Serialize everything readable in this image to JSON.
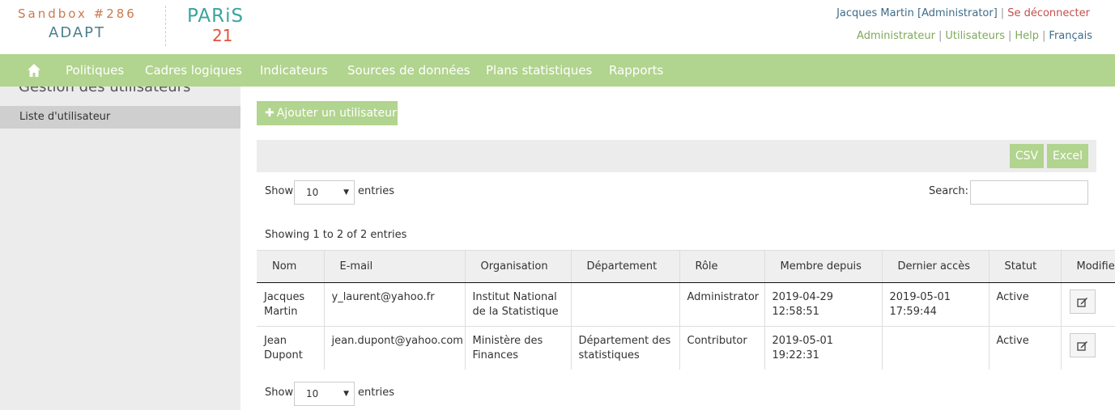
{
  "header": {
    "sandbox": "Sandbox #286",
    "adapt": "ADAPT",
    "paris": "PARiS",
    "paris_num": "21",
    "user": "Jacques Martin [Administrator]",
    "separator": "|",
    "logout": "Se déconnecter",
    "links": [
      "Administrateur",
      "Utilisateurs",
      "Help",
      "Français"
    ]
  },
  "nav": {
    "home_icon": "home-icon",
    "items": [
      "Politiques",
      "Cadres logiques",
      "Indicateurs",
      "Sources de données",
      "Plans statistiques",
      "Rapports"
    ]
  },
  "sidebar": {
    "title": "Gestion des utilisateurs",
    "items": [
      "Liste d'utilisateur"
    ]
  },
  "main": {
    "add_button": "Ajouter un utilisateur",
    "export_buttons": [
      "CSV",
      "Excel"
    ],
    "show_label": "Show",
    "entries_label": "entries",
    "page_length": "10",
    "search_label": "Search:",
    "search_value": "",
    "info": "Showing 1 to 2 of 2 entries"
  },
  "table": {
    "columns": [
      "Nom",
      "E-mail",
      "Organisation",
      "Département",
      "Rôle",
      "Membre depuis",
      "Dernier accès",
      "Statut",
      "Modifier"
    ],
    "rows": [
      {
        "name": "Jacques Martin",
        "email": "y_laurent@yahoo.fr",
        "organisation": "Institut National de la Statistique",
        "department": "",
        "role": "Administrator",
        "member_since": "2019-04-29 12:58:51",
        "last_access": "2019-05-01 17:59:44",
        "status": "Active"
      },
      {
        "name": "Jean Dupont",
        "email": "jean.dupont@yahoo.com",
        "organisation": "Ministère des Finances",
        "department": "Département des statistiques",
        "role": "Contributor",
        "member_since": "2019-05-01 19:22:31",
        "last_access": "",
        "status": "Active"
      }
    ]
  },
  "colors": {
    "accent_green": "#b1d48e",
    "link_blue": "#3e6c89",
    "logout_red": "#c0504d",
    "link_green": "#7fa95a"
  }
}
